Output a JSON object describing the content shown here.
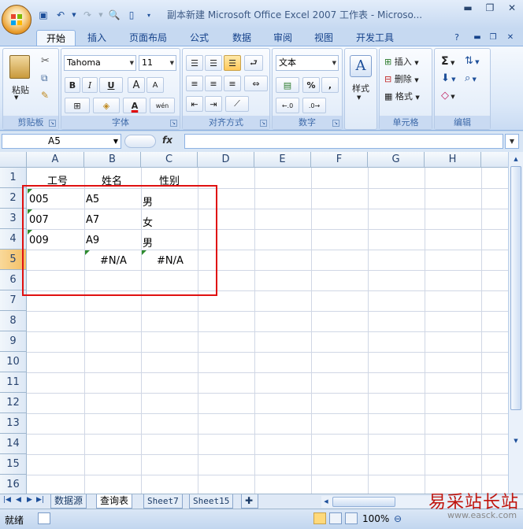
{
  "window": {
    "title": "副本新建 Microsoft Office Excel 2007 工作表 - Microso..."
  },
  "ribbon_tabs": [
    "开始",
    "插入",
    "页面布局",
    "公式",
    "数据",
    "审阅",
    "视图",
    "开发工具"
  ],
  "clipboard": {
    "paste": "粘贴",
    "label": "剪贴板"
  },
  "font": {
    "name": "Tahoma",
    "size": "11",
    "bold": "B",
    "italic": "I",
    "underline": "U",
    "grow": "A",
    "shrink": "A",
    "color_letter": "A",
    "label": "字体",
    "phonetic": "wén"
  },
  "alignment": {
    "label": "对齐方式"
  },
  "number": {
    "format": "文本",
    "percent": "%",
    "comma": ",",
    "label": "数字"
  },
  "styles": {
    "label": "样式"
  },
  "cells_group": {
    "insert": "插入",
    "delete": "删除",
    "format": "格式",
    "label": "单元格"
  },
  "editing": {
    "sum": "Σ",
    "label": "编辑"
  },
  "formula_bar": {
    "name_box": "A5",
    "fx": "fx",
    "value": ""
  },
  "columns": [
    "A",
    "B",
    "C",
    "D",
    "E",
    "F",
    "G",
    "H"
  ],
  "rows": [
    "1",
    "2",
    "3",
    "4",
    "5",
    "6",
    "7",
    "8",
    "9",
    "10",
    "11",
    "12",
    "13",
    "14",
    "15",
    "16"
  ],
  "cells": {
    "A1": "工号",
    "B1": "姓名",
    "C1": "性别",
    "A2": "005",
    "B2": "A5",
    "C2": "男",
    "A3": "007",
    "B3": "A7",
    "C3": "女",
    "A4": "009",
    "B4": "A9",
    "C4": "男",
    "B5": "#N/A",
    "C5": "#N/A"
  },
  "sheets": [
    "数据源",
    "查询表",
    "Sheet7",
    "Sheet15"
  ],
  "active_sheet": "查询表",
  "status": {
    "ready": "就绪",
    "zoom": "100%"
  },
  "watermark": {
    "text": "易采站长站",
    "url": "www.easck.com"
  },
  "colors": {
    "highlight_box": "#e01010",
    "error_triangle": "#2e8b2e",
    "font_color": "#e00000"
  }
}
